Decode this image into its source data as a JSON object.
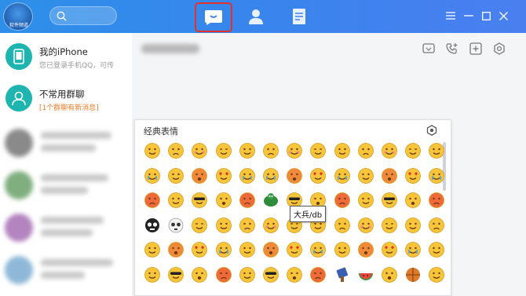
{
  "app": {
    "logo_text": "软件频道",
    "accent_color": "#3a84ee",
    "highlight_color": "#e0322b"
  },
  "topbar": {
    "search_icon": "search-icon",
    "nav": [
      {
        "name": "messages",
        "icon": "chat-bubble-icon",
        "active": true
      },
      {
        "name": "contacts",
        "icon": "person-icon",
        "active": false
      },
      {
        "name": "files",
        "icon": "document-icon",
        "active": false
      }
    ],
    "window_controls": [
      "menu-icon",
      "minimize-icon",
      "maximize-icon",
      "close-icon"
    ]
  },
  "sidebar": {
    "items": [
      {
        "name": "我的iPhone",
        "subtitle": "您已登录手机QQ，可传",
        "icon": "phone-icon"
      },
      {
        "name": "不常用群聊",
        "subtitle": "[1个群聊有新消息]",
        "icon": "group-icon"
      }
    ]
  },
  "chat": {
    "toolbar_icons": [
      "screen-share-icon",
      "voice-call-icon",
      "add-member-icon",
      "settings-icon"
    ]
  },
  "emoji_panel": {
    "title": "经典表情",
    "tooltip": "大兵/db",
    "settings_icon": "gear-icon",
    "rows": 6,
    "cols": 13
  }
}
